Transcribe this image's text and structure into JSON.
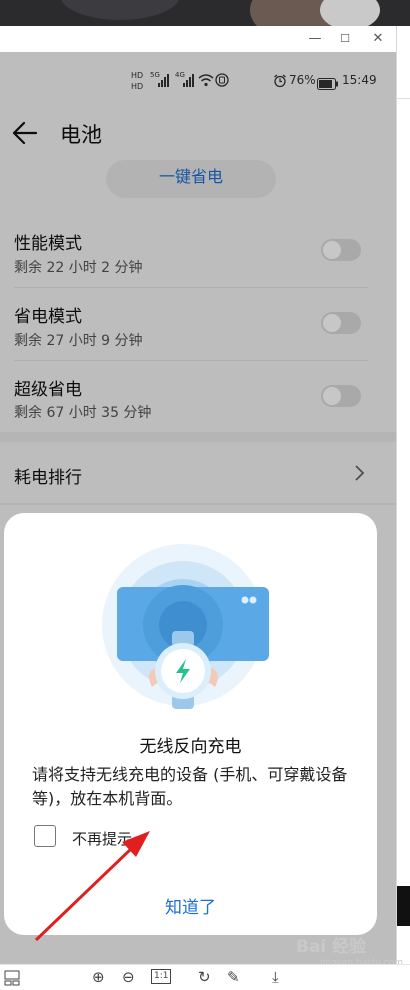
{
  "window": {
    "minimize_glyph": "—",
    "maximize_glyph": "☐",
    "close_glyph": "✕"
  },
  "status_bar": {
    "hd1": "HD",
    "hd2": "HD",
    "net1": "5G",
    "net2": "4G",
    "battery_percent": "76%",
    "time": "15:49"
  },
  "header": {
    "title": "电池",
    "save_power_button": "一键省电"
  },
  "modes": [
    {
      "title": "性能模式",
      "subtitle": "剩余 22 小时 2 分钟",
      "enabled": false
    },
    {
      "title": "省电模式",
      "subtitle": "剩余 27 小时 9 分钟",
      "enabled": false
    },
    {
      "title": "超级省电",
      "subtitle": "剩余 67 小时 35 分钟",
      "enabled": false
    }
  ],
  "ranking": {
    "label": "耗电排行"
  },
  "dialog": {
    "title": "无线反向充电",
    "message": "请将支持无线充电的设备 (手机、可穿戴设备等)，放在本机背面。",
    "checkbox_label": "不再提示",
    "ok_button": "知道了"
  },
  "toolbar": {
    "zoom_in": "⊕",
    "zoom_out": "⊖",
    "actual_size": "1:1",
    "rotate": "↻",
    "edit": "✎",
    "download": "⤓"
  },
  "watermark": {
    "text": "Bai 经验",
    "sub": "jingyan.baidu.com"
  },
  "colors": {
    "accent": "#1c6fd3",
    "illustration": "#5aa9e6",
    "charge_icon": "#27c28a"
  }
}
